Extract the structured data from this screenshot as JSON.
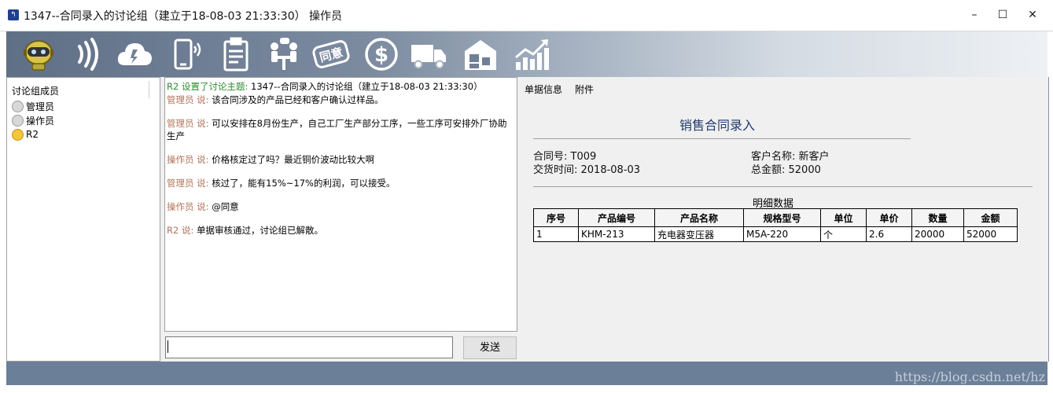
{
  "window": {
    "title": "1347--合同录入的讨论组（建立于18-08-03 21:33:30） 操作员",
    "minimize_glyph": "–",
    "maximize_glyph": "☐",
    "close_glyph": "✕"
  },
  "toolbar": {
    "items": [
      {
        "icon": "robot-avatar-icon"
      },
      {
        "icon": "sound-waves-icon"
      },
      {
        "icon": "cloud-icon"
      },
      {
        "icon": "mobile-phone-icon"
      },
      {
        "icon": "clipboard-icon"
      },
      {
        "icon": "meeting-icon"
      },
      {
        "icon": "agree-stamp-icon",
        "stamp_text": "同意"
      },
      {
        "icon": "dollar-icon",
        "symbol": "$"
      },
      {
        "icon": "delivery-truck-icon"
      },
      {
        "icon": "warehouse-icon"
      },
      {
        "icon": "growth-chart-icon"
      }
    ]
  },
  "members": {
    "header": "讨论组成员",
    "list": [
      {
        "name": "管理员",
        "status": "offline"
      },
      {
        "name": "操作员",
        "status": "offline"
      },
      {
        "name": "R2",
        "status": "online"
      }
    ]
  },
  "chat": {
    "messages": [
      {
        "who": "R2 设置了讨论主题:",
        "text": "1347--合同录入的讨论组（建立于18-08-03 21:33:30）"
      },
      {
        "who": "管理员 说:",
        "text": "该合同涉及的产品已经和客户确认过样品。"
      },
      {
        "who": "管理员 说:",
        "text": "可以安排在8月份生产，自己工厂生产部分工序，一些工序可安排外厂协助生产"
      },
      {
        "who": "操作员 说:",
        "text": "价格核定过了吗？最近铜价波动比较大啊"
      },
      {
        "who": "管理员 说:",
        "text": "核过了，能有15%~17%的利润，可以接受。"
      },
      {
        "who": "操作员 说:",
        "text": "@同意"
      },
      {
        "who": "R2 说:",
        "text": "单据审核通过，讨论组已解散。"
      }
    ],
    "input_value": "",
    "send_label": "发送"
  },
  "tabs": [
    {
      "label": "单据信息"
    },
    {
      "label": "附件"
    }
  ],
  "document": {
    "title": "销售合同录入",
    "contract_no": "合同号: T009",
    "delivery_date": "交货时间: 2018-08-03",
    "customer": "客户名称: 新客户",
    "total": "总金额: 52000",
    "detail_title": "明细数据",
    "columns": [
      "序号",
      "产品编号",
      "产品名称",
      "规格型号",
      "单位",
      "单价",
      "数量",
      "金额"
    ],
    "rows": [
      [
        "1",
        "KHM-213",
        "充电器变压器",
        "M5A-220",
        "个",
        "2.6",
        "20000",
        "52000"
      ]
    ]
  },
  "watermark": "https://blog.csdn.net/hz",
  "colors": {
    "statusbar": "#6b7f98",
    "speaker_name": "#b0745a",
    "topic_name": "#2e8b2e",
    "doc_title": "#1f3a6b"
  }
}
